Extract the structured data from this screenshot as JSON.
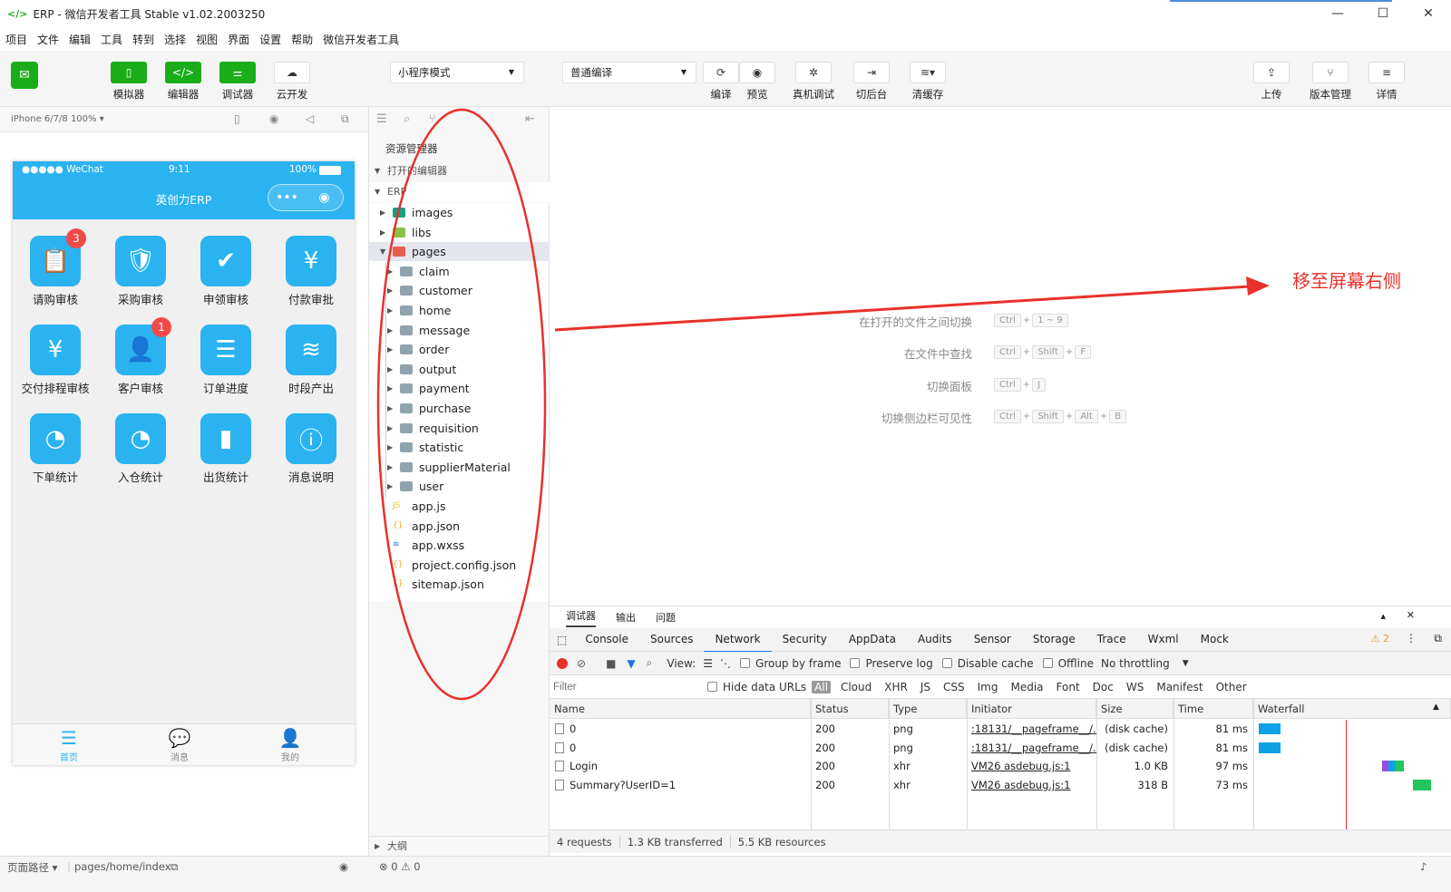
{
  "window": {
    "title": "ERP - 微信开发者工具 Stable v1.02.2003250",
    "controls": [
      "—",
      "☐",
      "✕"
    ]
  },
  "menu": [
    "项目",
    "文件",
    "编辑",
    "工具",
    "转到",
    "选择",
    "视图",
    "界面",
    "设置",
    "帮助",
    "微信开发者工具"
  ],
  "toolbar": {
    "simulator": "模拟器",
    "editor": "编辑器",
    "debugger": "调试器",
    "cloud": "云开发",
    "mode": "小程序模式",
    "compile_mode": "普通编译",
    "compile": "编译",
    "preview": "预览",
    "remote_debug": "真机调试",
    "background": "切后台",
    "clear_cache": "清缓存",
    "upload": "上传",
    "version": "版本管理",
    "details": "详情"
  },
  "simulator": {
    "device": "iPhone 6/7/8 100% ▾",
    "carrier": "●●●●● WeChat",
    "time": "9:11",
    "battery": "100%",
    "nav_title": "英创力ERP",
    "items": [
      {
        "label": "请购审核",
        "icon": "📋",
        "badge": "3"
      },
      {
        "label": "采购审核",
        "icon": "🛡",
        "badge": ""
      },
      {
        "label": "申领审核",
        "icon": "✔",
        "badge": ""
      },
      {
        "label": "付款审批",
        "icon": "¥",
        "badge": ""
      },
      {
        "label": "交付排程审核",
        "icon": "¥",
        "badge": ""
      },
      {
        "label": "客户审核",
        "icon": "👤",
        "badge": "1"
      },
      {
        "label": "订单进度",
        "icon": "☰",
        "badge": ""
      },
      {
        "label": "时段产出",
        "icon": "≋",
        "badge": ""
      },
      {
        "label": "下单统计",
        "icon": "◔",
        "badge": ""
      },
      {
        "label": "入仓统计",
        "icon": "◔",
        "badge": ""
      },
      {
        "label": "出货统计",
        "icon": "▮",
        "badge": ""
      },
      {
        "label": "消息说明",
        "icon": "ⓘ",
        "badge": ""
      }
    ],
    "tabs": [
      {
        "label": "首页",
        "icon": "☰"
      },
      {
        "label": "消息",
        "icon": "💬"
      },
      {
        "label": "我的",
        "icon": "👤"
      }
    ]
  },
  "explorer": {
    "title": "资源管理器",
    "open_editors": "打开的编辑器",
    "project": "ERP",
    "outline": "大纲",
    "tree": [
      {
        "name": "images",
        "type": "folder",
        "color": "#16a085",
        "level": 0,
        "expanded": false
      },
      {
        "name": "libs",
        "type": "folder",
        "color": "#8bc34a",
        "level": 0,
        "expanded": false
      },
      {
        "name": "pages",
        "type": "folder",
        "color": "#e85d4a",
        "level": 0,
        "expanded": true
      },
      {
        "name": "claim",
        "type": "folder",
        "color": "#90a4ae",
        "level": 1,
        "expanded": false
      },
      {
        "name": "customer",
        "type": "folder",
        "color": "#90a4ae",
        "level": 1,
        "expanded": false
      },
      {
        "name": "home",
        "type": "folder",
        "color": "#90a4ae",
        "level": 1,
        "expanded": false
      },
      {
        "name": "message",
        "type": "folder",
        "color": "#90a4ae",
        "level": 1,
        "expanded": false
      },
      {
        "name": "order",
        "type": "folder",
        "color": "#90a4ae",
        "level": 1,
        "expanded": false
      },
      {
        "name": "output",
        "type": "folder",
        "color": "#90a4ae",
        "level": 1,
        "expanded": false
      },
      {
        "name": "payment",
        "type": "folder",
        "color": "#90a4ae",
        "level": 1,
        "expanded": false
      },
      {
        "name": "purchase",
        "type": "folder",
        "color": "#90a4ae",
        "level": 1,
        "expanded": false
      },
      {
        "name": "requisition",
        "type": "folder",
        "color": "#90a4ae",
        "level": 1,
        "expanded": false
      },
      {
        "name": "statistic",
        "type": "folder",
        "color": "#90a4ae",
        "level": 1,
        "expanded": false
      },
      {
        "name": "supplierMaterial",
        "type": "folder",
        "color": "#90a4ae",
        "level": 1,
        "expanded": false
      },
      {
        "name": "user",
        "type": "folder",
        "color": "#90a4ae",
        "level": 1,
        "expanded": false
      },
      {
        "name": "app.js",
        "type": "js",
        "color": "#f4c430",
        "level": 0
      },
      {
        "name": "app.json",
        "type": "json",
        "color": "#f0a830",
        "level": 0
      },
      {
        "name": "app.wxss",
        "type": "wxss",
        "color": "#2f7fd6",
        "level": 0
      },
      {
        "name": "project.config.json",
        "type": "json",
        "color": "#f0a830",
        "level": 0
      },
      {
        "name": "sitemap.json",
        "type": "json",
        "color": "#f0a830",
        "level": 0
      }
    ]
  },
  "editor": {
    "shortcuts": [
      {
        "label": "在打开的文件之间切换",
        "keys": [
          "Ctrl",
          "1 ~ 9"
        ]
      },
      {
        "label": "在文件中查找",
        "keys": [
          "Ctrl",
          "Shift",
          "F"
        ]
      },
      {
        "label": "切换面板",
        "keys": [
          "Ctrl",
          "J"
        ]
      },
      {
        "label": "切换侧边栏可见性",
        "keys": [
          "Ctrl",
          "Shift",
          "Alt",
          "B"
        ]
      }
    ]
  },
  "debugger": {
    "panel_tabs": [
      "调试器",
      "输出",
      "问题"
    ],
    "dev_tabs": [
      "Console",
      "Sources",
      "Network",
      "Security",
      "AppData",
      "Audits",
      "Sensor",
      "Storage",
      "Trace",
      "Wxml",
      "Mock"
    ],
    "active_tab": "Network",
    "warnings": "⚠ 2",
    "view_label": "View:",
    "group_by_frame": "Group by frame",
    "preserve_log": "Preserve log",
    "disable_cache": "Disable cache",
    "offline": "Offline",
    "throttling": "No throttling",
    "filter_placeholder": "Filter",
    "hide_data_urls": "Hide data URLs",
    "filter_types": [
      "All",
      "Cloud",
      "XHR",
      "JS",
      "CSS",
      "Img",
      "Media",
      "Font",
      "Doc",
      "WS",
      "Manifest",
      "Other"
    ],
    "columns": [
      "Name",
      "Status",
      "Type",
      "Initiator",
      "Size",
      "Time",
      "Waterfall"
    ],
    "rows": [
      {
        "name": "0",
        "status": "200",
        "type": "png",
        "initiator": ":18131/__pageframe__/...",
        "size": "(disk cache)",
        "time": "81 ms"
      },
      {
        "name": "0",
        "status": "200",
        "type": "png",
        "initiator": ":18131/__pageframe__/...",
        "size": "(disk cache)",
        "time": "81 ms"
      },
      {
        "name": "Login",
        "status": "200",
        "type": "xhr",
        "initiator": "VM26 asdebug.js:1",
        "size": "1.0 KB",
        "time": "97 ms"
      },
      {
        "name": "Summary?UserID=1",
        "status": "200",
        "type": "xhr",
        "initiator": "VM26 asdebug.js:1",
        "size": "318 B",
        "time": "73 ms"
      }
    ],
    "footer": [
      "4 requests",
      "1.3 KB transferred",
      "5.5 KB resources"
    ]
  },
  "statusbar": {
    "path_label": "页面路径 ▾",
    "path": "pages/home/index",
    "errors": "⊗ 0 ⚠ 0"
  },
  "annotation": {
    "text": "移至屏幕右侧",
    "color": "#e8312a"
  }
}
